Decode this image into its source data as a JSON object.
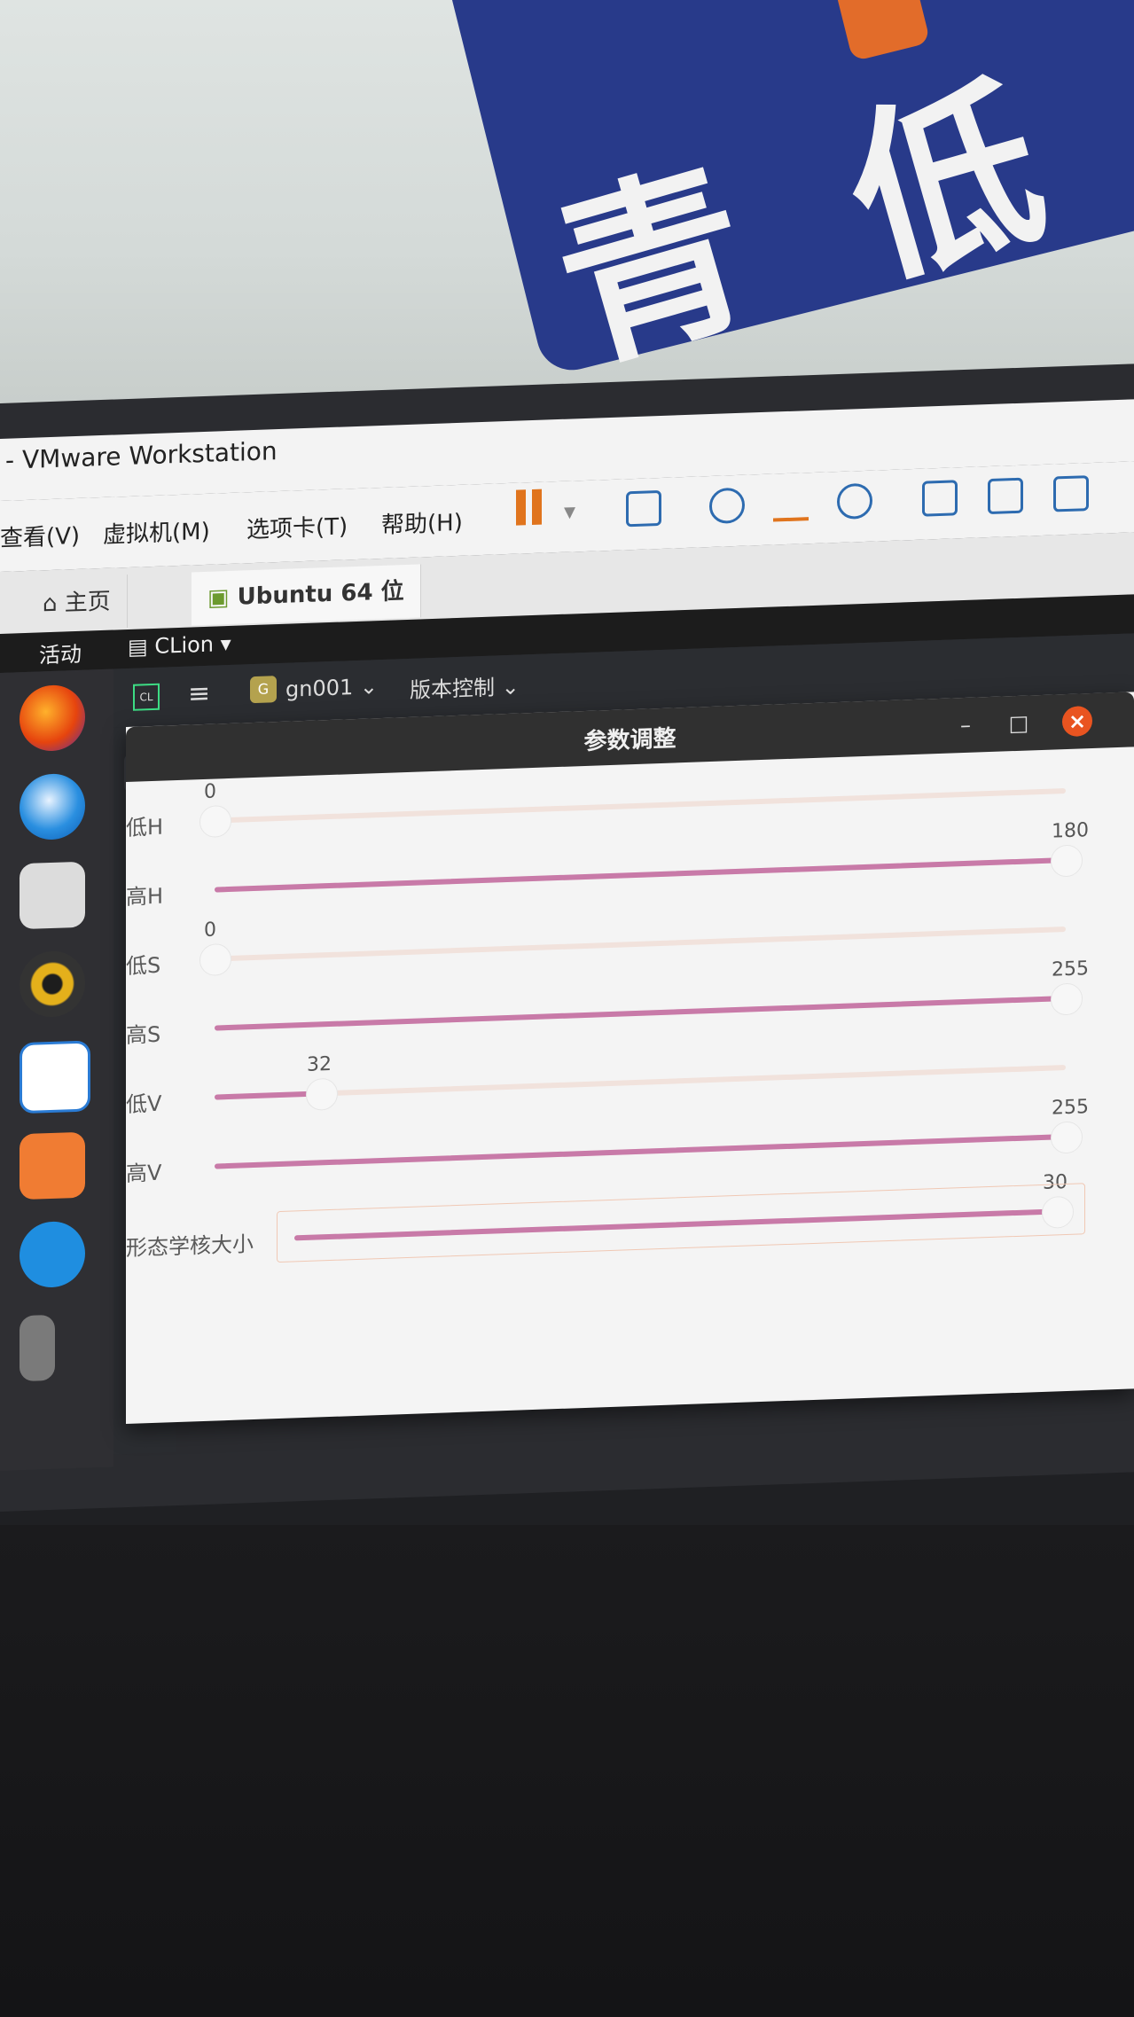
{
  "vmware": {
    "window_title": "- VMware Workstation",
    "menu": [
      "查看(V)",
      "虚拟机(M)",
      "选项卡(T)",
      "帮助(H)"
    ],
    "tabs": [
      "主页",
      "Ubuntu 64 位"
    ]
  },
  "ubuntu": {
    "activities": "活动",
    "app_name": "CLion"
  },
  "clion": {
    "project": "gn001",
    "vcs": "版本控制",
    "project_badge": "G"
  },
  "dialog": {
    "title": "参数调整",
    "sliders": [
      {
        "label": "低H",
        "value": "0",
        "fraction": 0.0
      },
      {
        "label": "高H",
        "value": "180",
        "fraction": 1.0
      },
      {
        "label": "低S",
        "value": "0",
        "fraction": 0.0
      },
      {
        "label": "高S",
        "value": "255",
        "fraction": 1.0
      },
      {
        "label": "低V",
        "value": "32",
        "fraction": 0.125
      },
      {
        "label": "高V",
        "value": "255",
        "fraction": 1.0
      },
      {
        "label": "形态学核大小",
        "value": "30",
        "fraction": 1.0
      }
    ]
  }
}
